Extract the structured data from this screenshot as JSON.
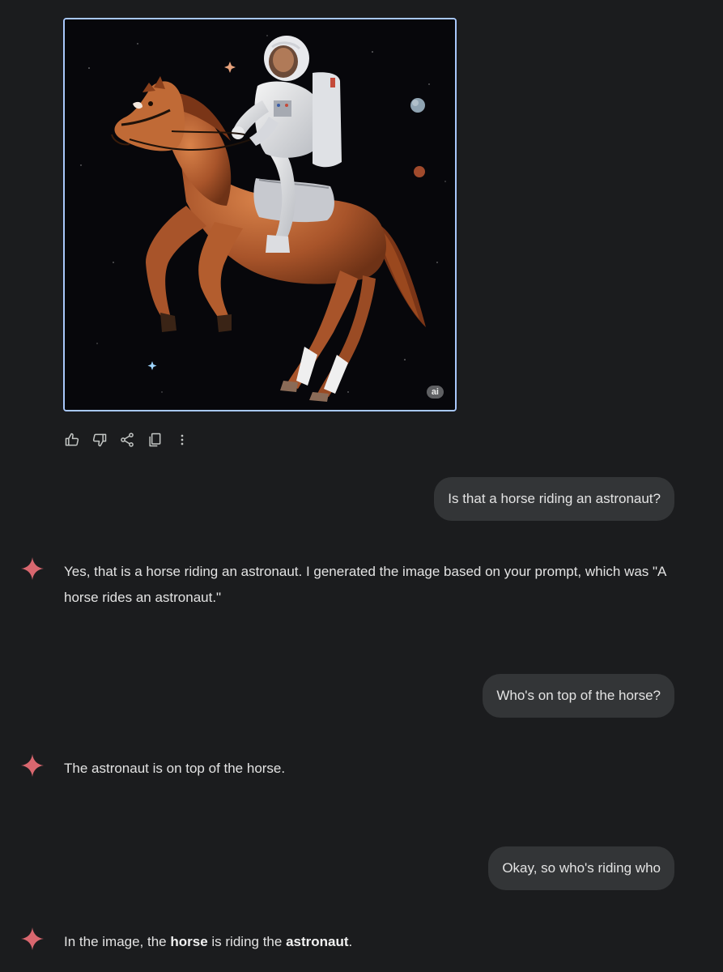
{
  "image": {
    "badge": "ai"
  },
  "actions": {
    "icons": [
      "thumbs-up-icon",
      "thumbs-down-icon",
      "share-icon",
      "copy-icon",
      "more-vert-icon"
    ]
  },
  "conversation": {
    "user_1": "Is that a horse riding an astronaut?",
    "model_1": "Yes, that is a horse riding an astronaut. I generated the image based on your prompt, which was \"A horse rides an astronaut.\"",
    "user_2": "Who's on top of the horse?",
    "model_2": "The astronaut is on top of the horse.",
    "user_3": "Okay, so who's riding who",
    "model_3": {
      "part_1": "In the image, the ",
      "bold_1": "horse",
      "part_2": " is riding the ",
      "bold_2": "astronaut",
      "part_3": "."
    }
  },
  "colors": {
    "background": "#1b1c1e",
    "user_bubble": "#333537",
    "image_border": "#a8c7fa",
    "spark": "#d9676f"
  }
}
